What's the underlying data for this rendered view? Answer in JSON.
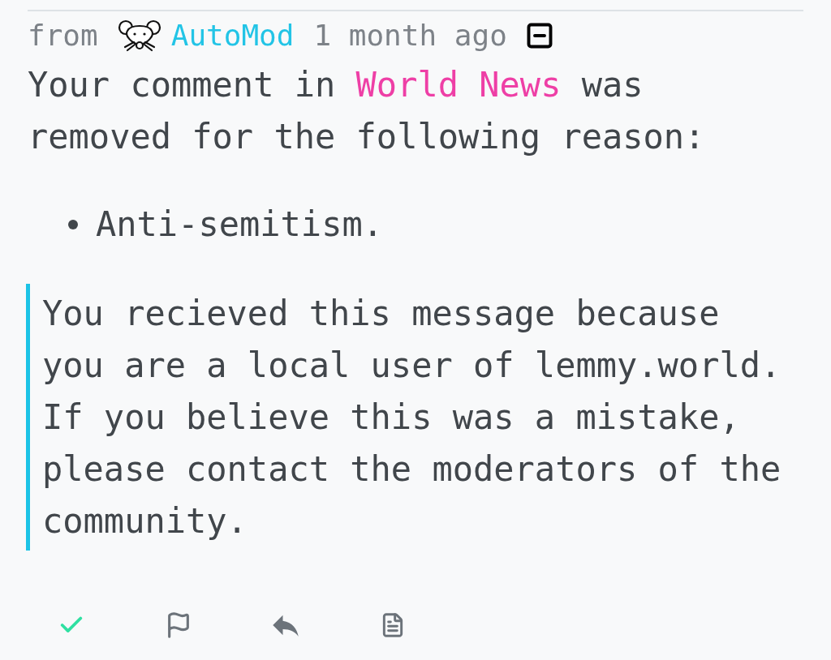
{
  "message": {
    "header": {
      "prefix": "from",
      "sender": "AutoMod",
      "time": "1 month ago"
    },
    "body": {
      "before": "Your comment in ",
      "community": "World News",
      "after": " was removed for the following reason:"
    },
    "reasons": [
      "Anti-semitism."
    ],
    "quote": "You recieved this message because you are a local user of lemmy.world. If you believe this was a mistake, please contact the moderators of the community."
  },
  "actions": [
    {
      "kind": "check"
    },
    {
      "kind": "flag"
    },
    {
      "kind": "reply"
    },
    {
      "kind": "source"
    }
  ]
}
